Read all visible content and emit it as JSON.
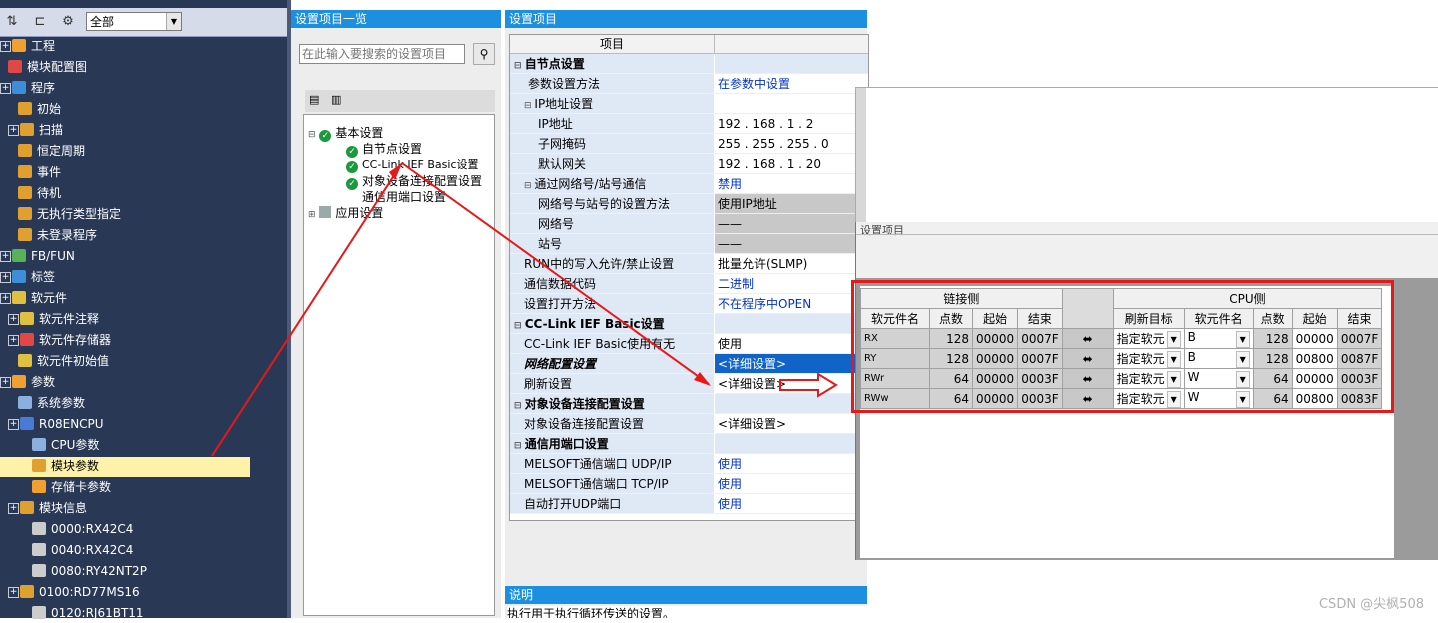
{
  "nav": {
    "filter": "全部",
    "items": [
      {
        "label": "工程"
      },
      {
        "label": "模块配置图"
      },
      {
        "label": "程序"
      },
      {
        "label": "初始"
      },
      {
        "label": "扫描"
      },
      {
        "label": "恒定周期"
      },
      {
        "label": "事件"
      },
      {
        "label": "待机"
      },
      {
        "label": "无执行类型指定"
      },
      {
        "label": "未登录程序"
      },
      {
        "label": "FB/FUN"
      },
      {
        "label": "标签"
      },
      {
        "label": "软元件"
      },
      {
        "label": "软元件注释"
      },
      {
        "label": "软元件存储器"
      },
      {
        "label": "软元件初始值"
      },
      {
        "label": "参数"
      },
      {
        "label": "系统参数"
      },
      {
        "label": "R08ENCPU"
      },
      {
        "label": "CPU参数"
      },
      {
        "label": "模块参数"
      },
      {
        "label": "存储卡参数"
      },
      {
        "label": "模块信息"
      },
      {
        "label": "0000:RX42C4"
      },
      {
        "label": "0040:RX42C4"
      },
      {
        "label": "0080:RY42NT2P"
      },
      {
        "label": "0100:RD77MS16"
      },
      {
        "label": "0120:RJ61BT11"
      }
    ]
  },
  "list_panel": {
    "title": "设置项目一览",
    "search_placeholder": "在此输入要搜索的设置项目",
    "tree": [
      {
        "label": "基本设置"
      },
      {
        "label": "自节点设置"
      },
      {
        "label": "CC-Link IEF Basic设置"
      },
      {
        "label": "对象设备连接配置设置"
      },
      {
        "label": "通信用端口设置"
      },
      {
        "label": "应用设置"
      }
    ]
  },
  "grid_panel": {
    "title": "设置项目",
    "col_item": "项目",
    "rows": [
      {
        "k": "自节点设置",
        "v": ""
      },
      {
        "k": "参数设置方法",
        "v": "在参数中设置"
      },
      {
        "k": "IP地址设置",
        "v": ""
      },
      {
        "k": "IP地址",
        "v": "192 . 168 .  1 .  2"
      },
      {
        "k": "子网掩码",
        "v": "255 . 255 . 255 .  0"
      },
      {
        "k": "默认网关",
        "v": "192 . 168 .  1 . 20"
      },
      {
        "k": "通过网络号/站号通信",
        "v": "禁用"
      },
      {
        "k": "网络号与站号的设置方法",
        "v": "使用IP地址"
      },
      {
        "k": "网络号",
        "v": "——"
      },
      {
        "k": "站号",
        "v": "——"
      },
      {
        "k": "RUN中的写入允许/禁止设置",
        "v": "批量允许(SLMP)"
      },
      {
        "k": "通信数据代码",
        "v": "二进制"
      },
      {
        "k": "设置打开方法",
        "v": "不在程序中OPEN"
      },
      {
        "k": "CC-Link IEF Basic设置",
        "v": ""
      },
      {
        "k": "CC-Link IEF Basic使用有无",
        "v": "使用"
      },
      {
        "k": "网络配置设置",
        "v": "<详细设置>"
      },
      {
        "k": "刷新设置",
        "v": "<详细设置>"
      },
      {
        "k": "对象设备连接配置设置",
        "v": ""
      },
      {
        "k": "对象设备连接配置设置",
        "v": "<详细设置>"
      },
      {
        "k": "通信用端口设置",
        "v": ""
      },
      {
        "k": "MELSOFT通信端口 UDP/IP",
        "v": "使用"
      },
      {
        "k": "MELSOFT通信端口 TCP/IP",
        "v": "使用"
      },
      {
        "k": "自动打开UDP端口",
        "v": "使用"
      }
    ],
    "desc_title": "说明",
    "desc_text": "执行用于执行循环传送的设置。"
  },
  "refresh": {
    "dialog_title": "设置项目",
    "link_side": "链接侧",
    "cpu_side": "CPU侧",
    "headers_link": [
      "软元件名",
      "点数",
      "起始",
      "结束"
    ],
    "headers_cpu": [
      "刷新目标",
      "软元件名",
      "点数",
      "起始",
      "结束"
    ],
    "rows": [
      {
        "name": "RX",
        "points": "128",
        "start": "00000",
        "end": "0007F",
        "target": "指定软元件",
        "dev": "B",
        "cpoints": "128",
        "cstart": "00000",
        "cend": "0007F"
      },
      {
        "name": "RY",
        "points": "128",
        "start": "00000",
        "end": "0007F",
        "target": "指定软元件",
        "dev": "B",
        "cpoints": "128",
        "cstart": "00800",
        "cend": "0087F"
      },
      {
        "name": "RWr",
        "points": "64",
        "start": "00000",
        "end": "0003F",
        "target": "指定软元件",
        "dev": "W",
        "cpoints": "64",
        "cstart": "00000",
        "cend": "0003F"
      },
      {
        "name": "RWw",
        "points": "64",
        "start": "00000",
        "end": "0003F",
        "target": "指定软元件",
        "dev": "W",
        "cpoints": "64",
        "cstart": "00800",
        "cend": "0083F"
      }
    ]
  },
  "watermark": "CSDN @尖枫508",
  "colors": {
    "nav_bg": "#293955",
    "title_blue": "#1c8fe0",
    "annotation_red": "#e81818",
    "selected_row": "#fdf2a8"
  }
}
